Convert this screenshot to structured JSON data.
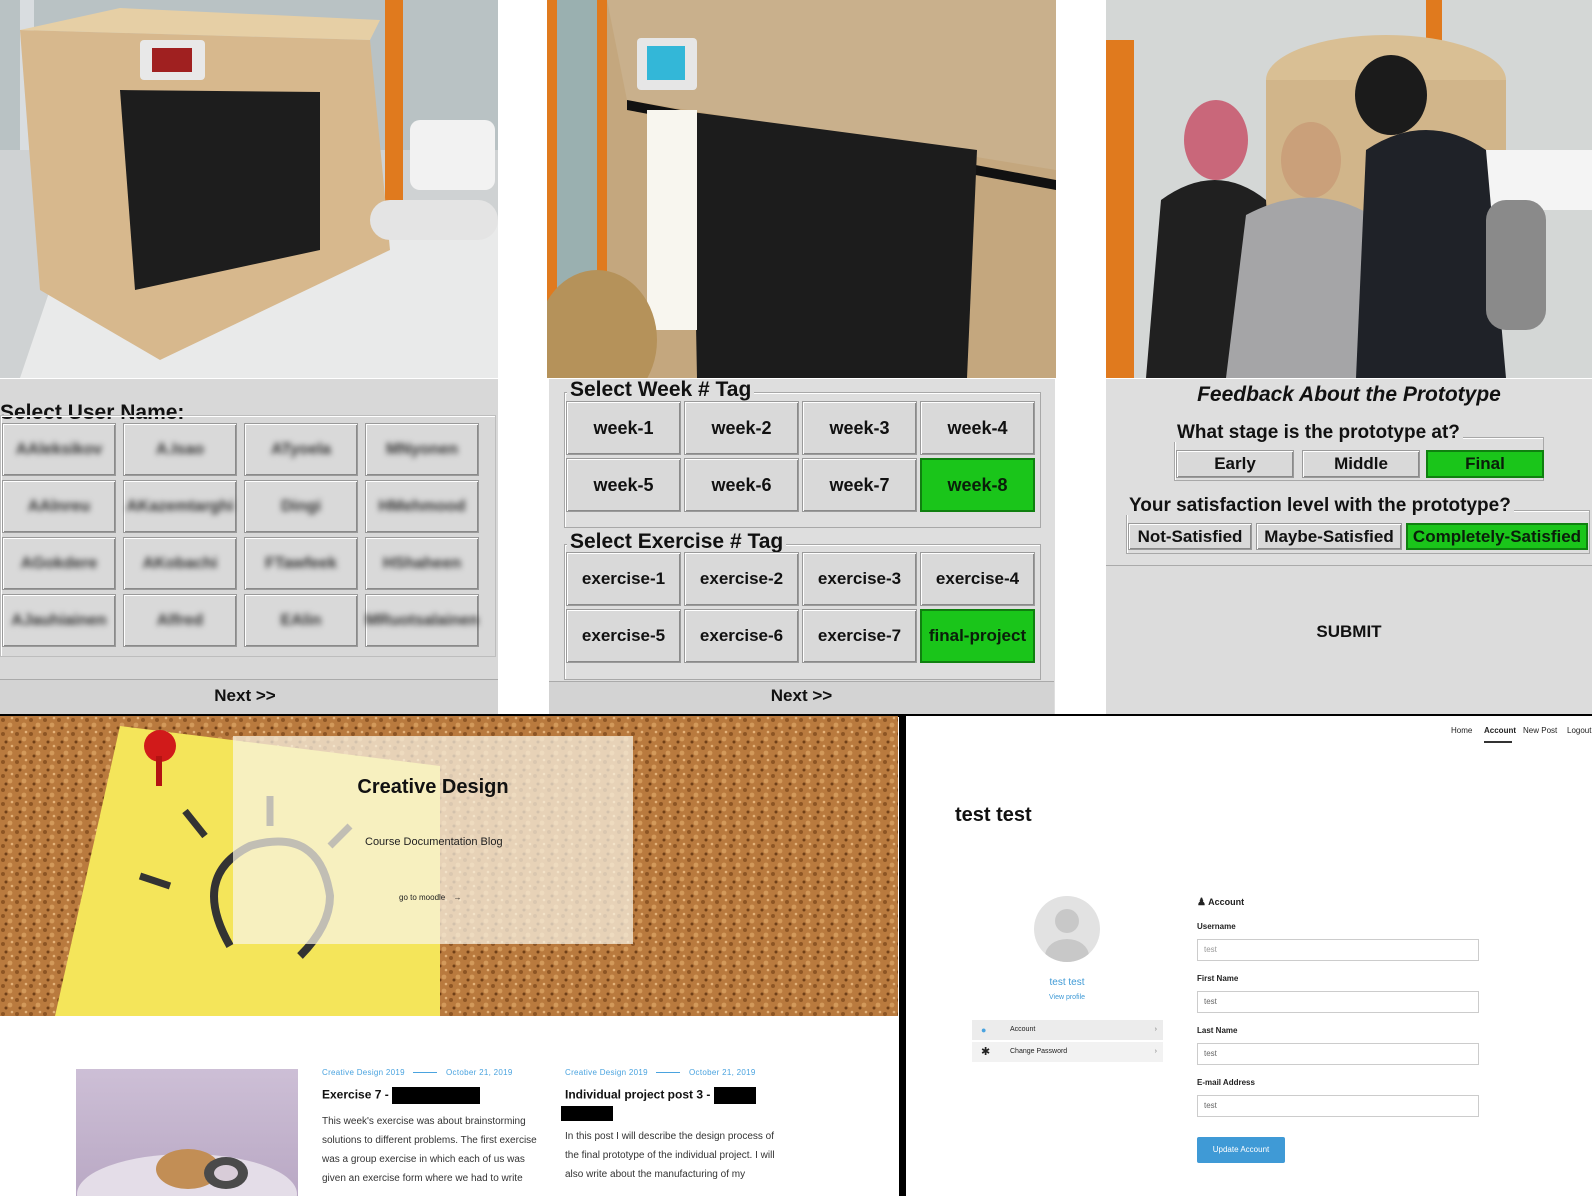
{
  "kiosk_ui": {
    "user_screen": {
      "title": "Select User Name:",
      "names": [
        "AAleksikov",
        "A.Isao",
        "ATyoela",
        "MNyonen",
        "AAlnreu",
        "AKazemtarghi",
        "Dingi",
        "HMehmood",
        "AGokdere",
        "AKobachi",
        "FTawfeek",
        "HShaheen",
        "AJauhiainen",
        "Alfred",
        "EAlin",
        "MRuotsalainen"
      ],
      "next": "Next >>"
    },
    "tag_screen": {
      "week_title": "Select Week # Tag",
      "weeks": [
        "week-1",
        "week-2",
        "week-3",
        "week-4",
        "week-5",
        "week-6",
        "week-7",
        "week-8"
      ],
      "week_selected": 7,
      "exercise_title": "Select Exercise # Tag",
      "exercises": [
        "exercise-1",
        "exercise-2",
        "exercise-3",
        "exercise-4",
        "exercise-5",
        "exercise-6",
        "exercise-7",
        "final-project"
      ],
      "exercise_selected": 7,
      "next": "Next >>"
    },
    "feedback_screen": {
      "title": "Feedback About the Prototype",
      "stage_question": "What stage is the prototype at?",
      "stages": [
        "Early",
        "Middle",
        "Final"
      ],
      "stage_selected": 2,
      "satisfaction_question": "Your satisfaction level with the prototype?",
      "satisfaction": [
        "Not-Satisfied",
        "Maybe-Satisfied",
        "Completely-Satisfied"
      ],
      "satisfaction_selected": 2,
      "submit": "SUBMIT"
    }
  },
  "blog": {
    "hero_title": "Creative Design",
    "hero_subtitle": "Course Documentation Blog",
    "hero_link": "go to moodle",
    "posts": [
      {
        "category": "Creative Design 2019",
        "date": "October 21, 2019",
        "title": "Exercise 7 -",
        "body": [
          "This week's exercise was about brainstorming",
          "solutions to different problems. The first exercise",
          "was a group exercise in which each of us was",
          "given an exercise form where we had to write"
        ]
      },
      {
        "category": "Creative Design 2019",
        "date": "October 21, 2019",
        "title": "Individual project post 3 -",
        "body": [
          "In this post I will describe the design process of",
          "the final prototype of the individual project. I will",
          "also write about the manufacturing of my"
        ]
      }
    ]
  },
  "account_page": {
    "nav": [
      "Home",
      "Account",
      "New Post",
      "Logout"
    ],
    "nav_active": "Account",
    "page_title": "test test",
    "profile_name": "test test",
    "view_profile": "View profile",
    "menu": [
      {
        "icon": "user-icon",
        "label": "Account"
      },
      {
        "icon": "asterisk-icon",
        "label": "Change Password"
      }
    ],
    "section_title": "Account",
    "fields": [
      {
        "label": "Username",
        "value": "test"
      },
      {
        "label": "First Name",
        "value": "test"
      },
      {
        "label": "Last Name",
        "value": "test"
      },
      {
        "label": "E-mail Address",
        "value": "test"
      }
    ],
    "update_button": "Update Account"
  },
  "colors": {
    "selected": "#1ac51a",
    "panel": "#dedede",
    "link": "#4aa3df",
    "button": "#3f9ad6"
  }
}
